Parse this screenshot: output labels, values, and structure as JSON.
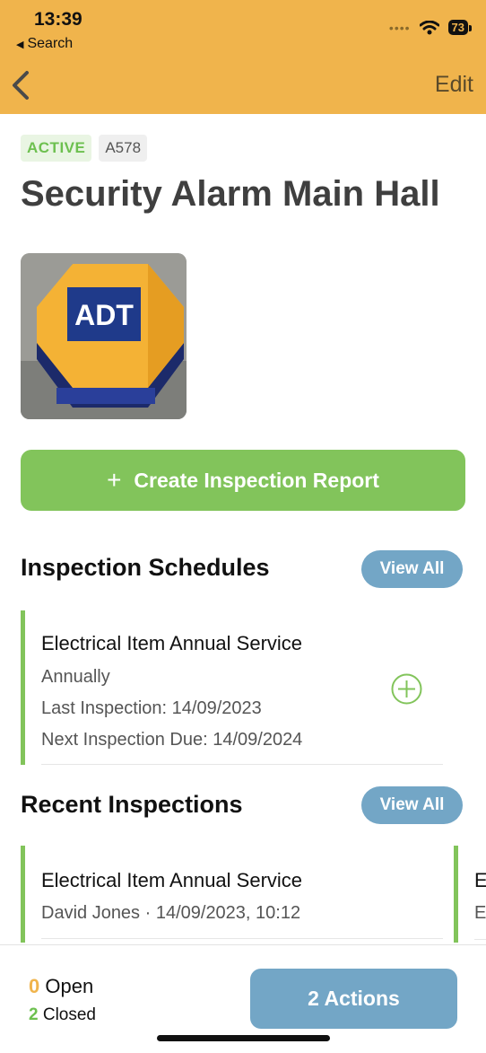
{
  "status_bar": {
    "time": "13:39",
    "back_app": "Search",
    "battery": "73"
  },
  "nav": {
    "edit_label": "Edit"
  },
  "asset": {
    "status_badge": "ACTIVE",
    "code": "A578",
    "title": "Security Alarm Main Hall",
    "photo_logo_text": "ADT"
  },
  "create_button": {
    "plus": "+",
    "label": "Create Inspection Report"
  },
  "schedules": {
    "title": "Inspection Schedules",
    "view_all": "View All",
    "items": [
      {
        "name": "Electrical Item Annual Service",
        "frequency": "Annually",
        "last": "Last Inspection: 14/09/2023",
        "next": "Next Inspection Due: 14/09/2024"
      }
    ]
  },
  "recent": {
    "title": "Recent Inspections",
    "view_all": "View All",
    "items": [
      {
        "name": "Electrical Item Annual Service",
        "meta": "David Jones · 14/09/2023, 10:12"
      },
      {
        "name": "E",
        "meta": "E"
      }
    ]
  },
  "footer": {
    "open_count": "0",
    "open_label": "Open",
    "closed_count": "2",
    "closed_label": "Closed",
    "actions_button": "2 Actions"
  },
  "colors": {
    "header": "#F0B44C",
    "green": "#82C45B",
    "blue_button": "#73A6C6"
  }
}
